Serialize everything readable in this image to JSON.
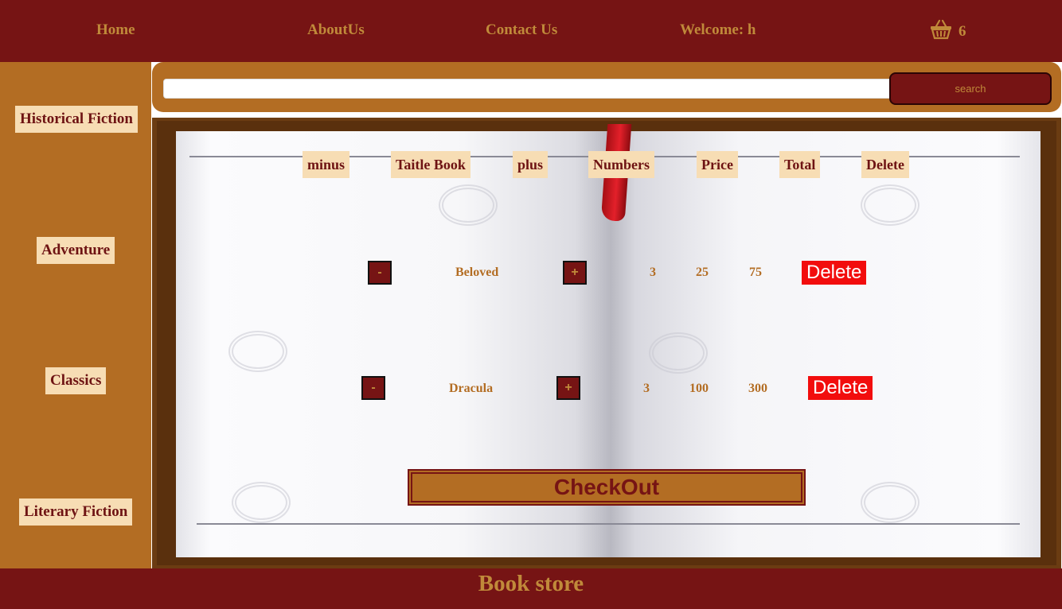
{
  "nav": {
    "home": "Home",
    "about": "AboutUs",
    "contact": "Contact Us",
    "welcome": "Welcome: h",
    "cart_count": "6"
  },
  "sidebar": {
    "categories": [
      "Historical Fiction",
      "Adventure",
      "Classics",
      "Literary Fiction"
    ]
  },
  "search": {
    "value": "",
    "placeholder": "",
    "button_label": "search"
  },
  "table": {
    "headers": [
      "minus",
      "Taitle Book",
      "plus",
      "Numbers",
      "Price",
      "Total",
      "Delete"
    ],
    "rows": [
      {
        "minus": "-",
        "title": "Beloved",
        "plus": "+",
        "number": "3",
        "price": "25",
        "total": "75",
        "delete": "Delete"
      },
      {
        "minus": "-",
        "title": "Dracula",
        "plus": "+",
        "number": "3",
        "price": "100",
        "total": "300",
        "delete": "Delete"
      }
    ]
  },
  "checkout_label": "CheckOut",
  "footer_title": "Book store",
  "colors": {
    "header_bg": "#761414",
    "accent": "#b36d23",
    "label_bg": "#f7ddb4",
    "delete_bg": "#f20d0d"
  },
  "icons": {
    "cart": "basket-icon"
  }
}
